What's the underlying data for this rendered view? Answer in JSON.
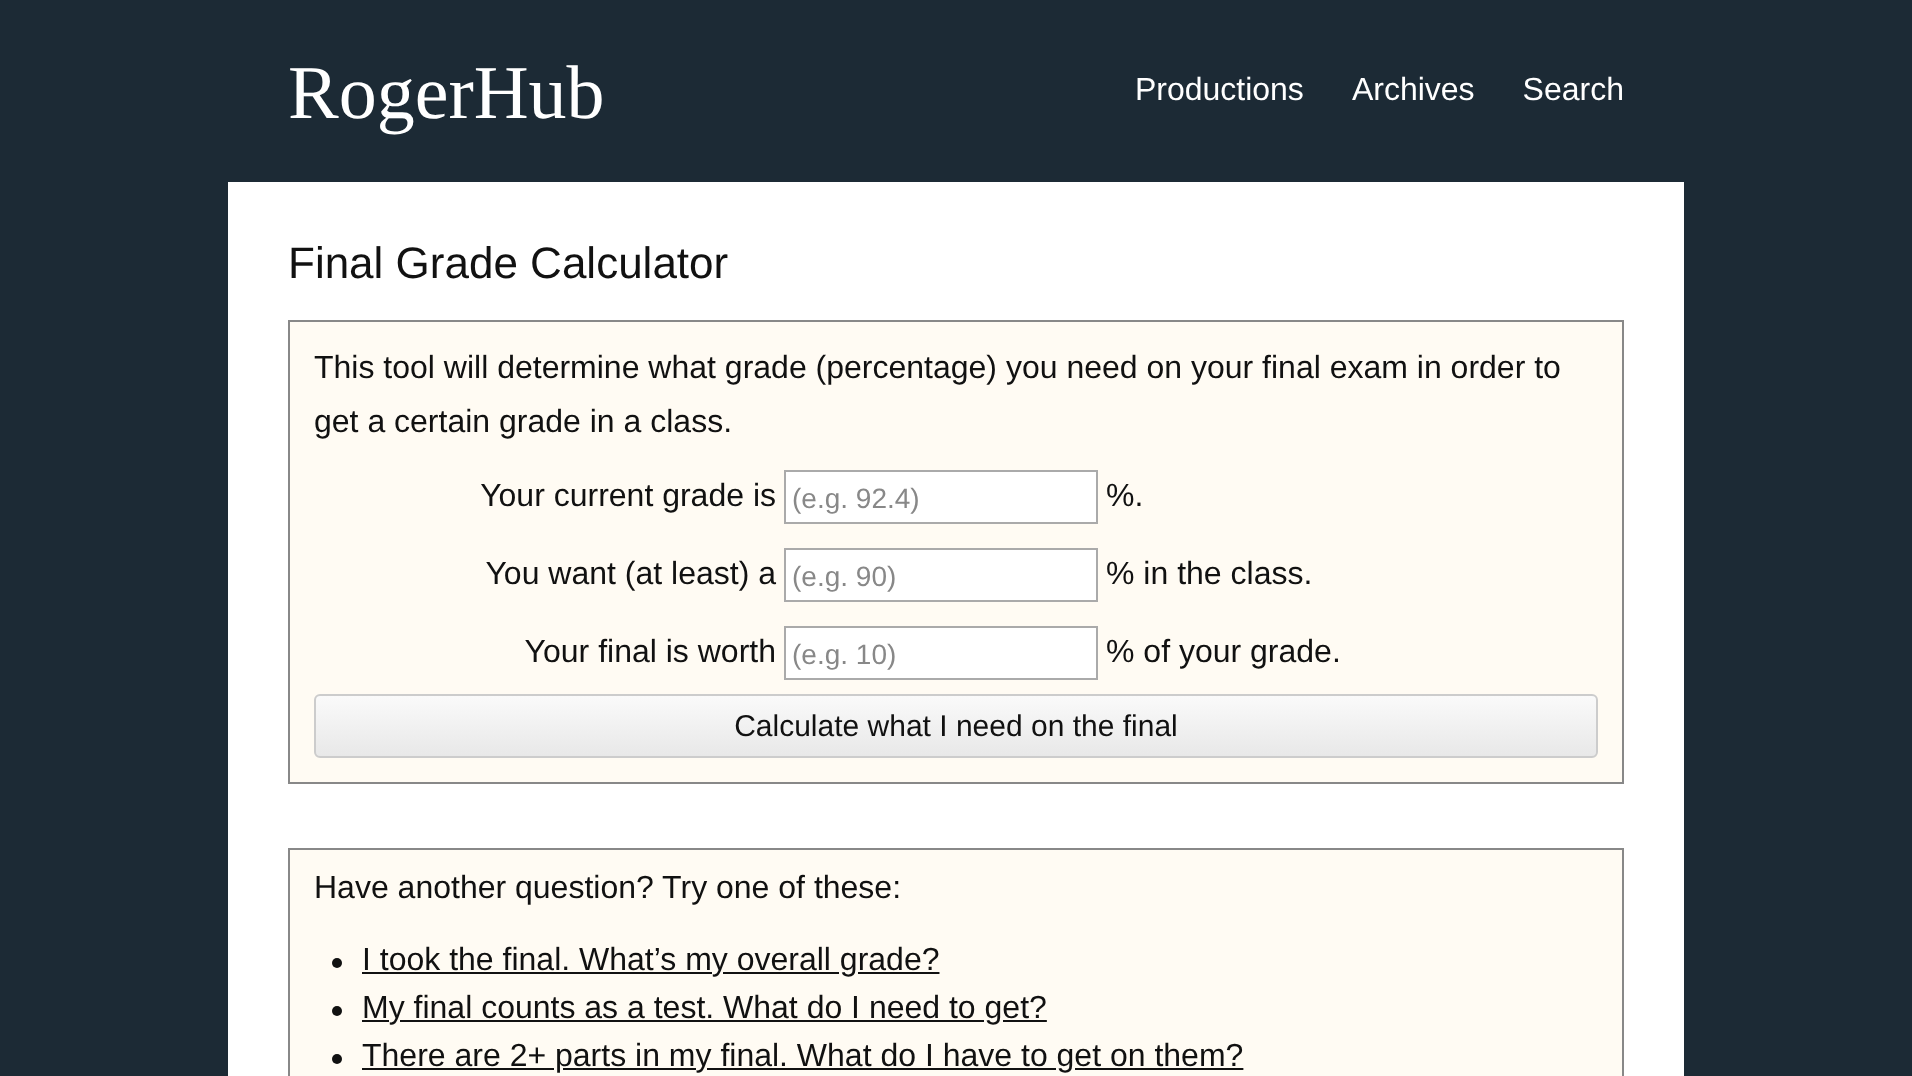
{
  "header": {
    "logo": "RogerHub",
    "nav": [
      "Productions",
      "Archives",
      "Search"
    ]
  },
  "title": "Final Grade Calculator",
  "calculator": {
    "intro": "This tool will determine what grade (percentage) you need on your final exam in order to get a certain grade in a class.",
    "fields": [
      {
        "label": "Your current grade is",
        "placeholder": "(e.g. 92.4)",
        "suffix": "%."
      },
      {
        "label": "You want (at least) a",
        "placeholder": "(e.g. 90)",
        "suffix": "% in the class."
      },
      {
        "label": "Your final is worth",
        "placeholder": "(e.g. 10)",
        "suffix": "% of your grade."
      }
    ],
    "button": "Calculate what I need on the final"
  },
  "other": {
    "heading": "Have another question? Try one of these:",
    "links": [
      "I took the final. What’s my overall grade?",
      "My final counts as a test. What do I need to get?",
      "There are 2+ parts in my final. What do I have to get on them?"
    ]
  }
}
